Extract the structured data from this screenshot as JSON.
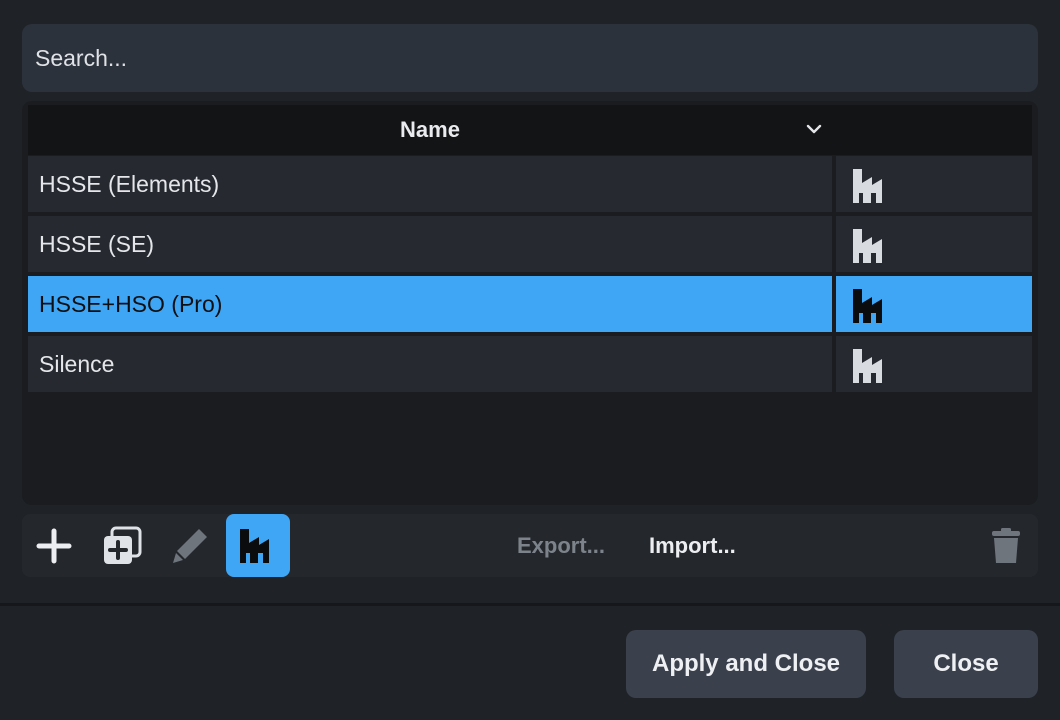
{
  "search": {
    "placeholder": "Search..."
  },
  "list": {
    "header": {
      "name_column": "Name"
    },
    "rows": [
      {
        "name": "HSSE (Elements)",
        "icon": "factory-icon",
        "selected": false
      },
      {
        "name": "HSSE (SE)",
        "icon": "factory-icon",
        "selected": false
      },
      {
        "name": "HSSE+HSO (Pro)",
        "icon": "factory-icon",
        "selected": true
      },
      {
        "name": "Silence",
        "icon": "factory-icon",
        "selected": false
      }
    ]
  },
  "toolbar": {
    "add_icon": "plus-icon",
    "duplicate_icon": "duplicate-icon",
    "edit_icon": "pencil-icon",
    "factory_icon": "factory-icon",
    "export_label": "Export...",
    "import_label": "Import...",
    "delete_icon": "trash-icon"
  },
  "footer": {
    "apply_label": "Apply and Close",
    "close_label": "Close"
  },
  "colors": {
    "accent": "#3ea6f5",
    "background": "#1f2226",
    "row_background": "#262a30",
    "button_background": "#3a414c"
  }
}
